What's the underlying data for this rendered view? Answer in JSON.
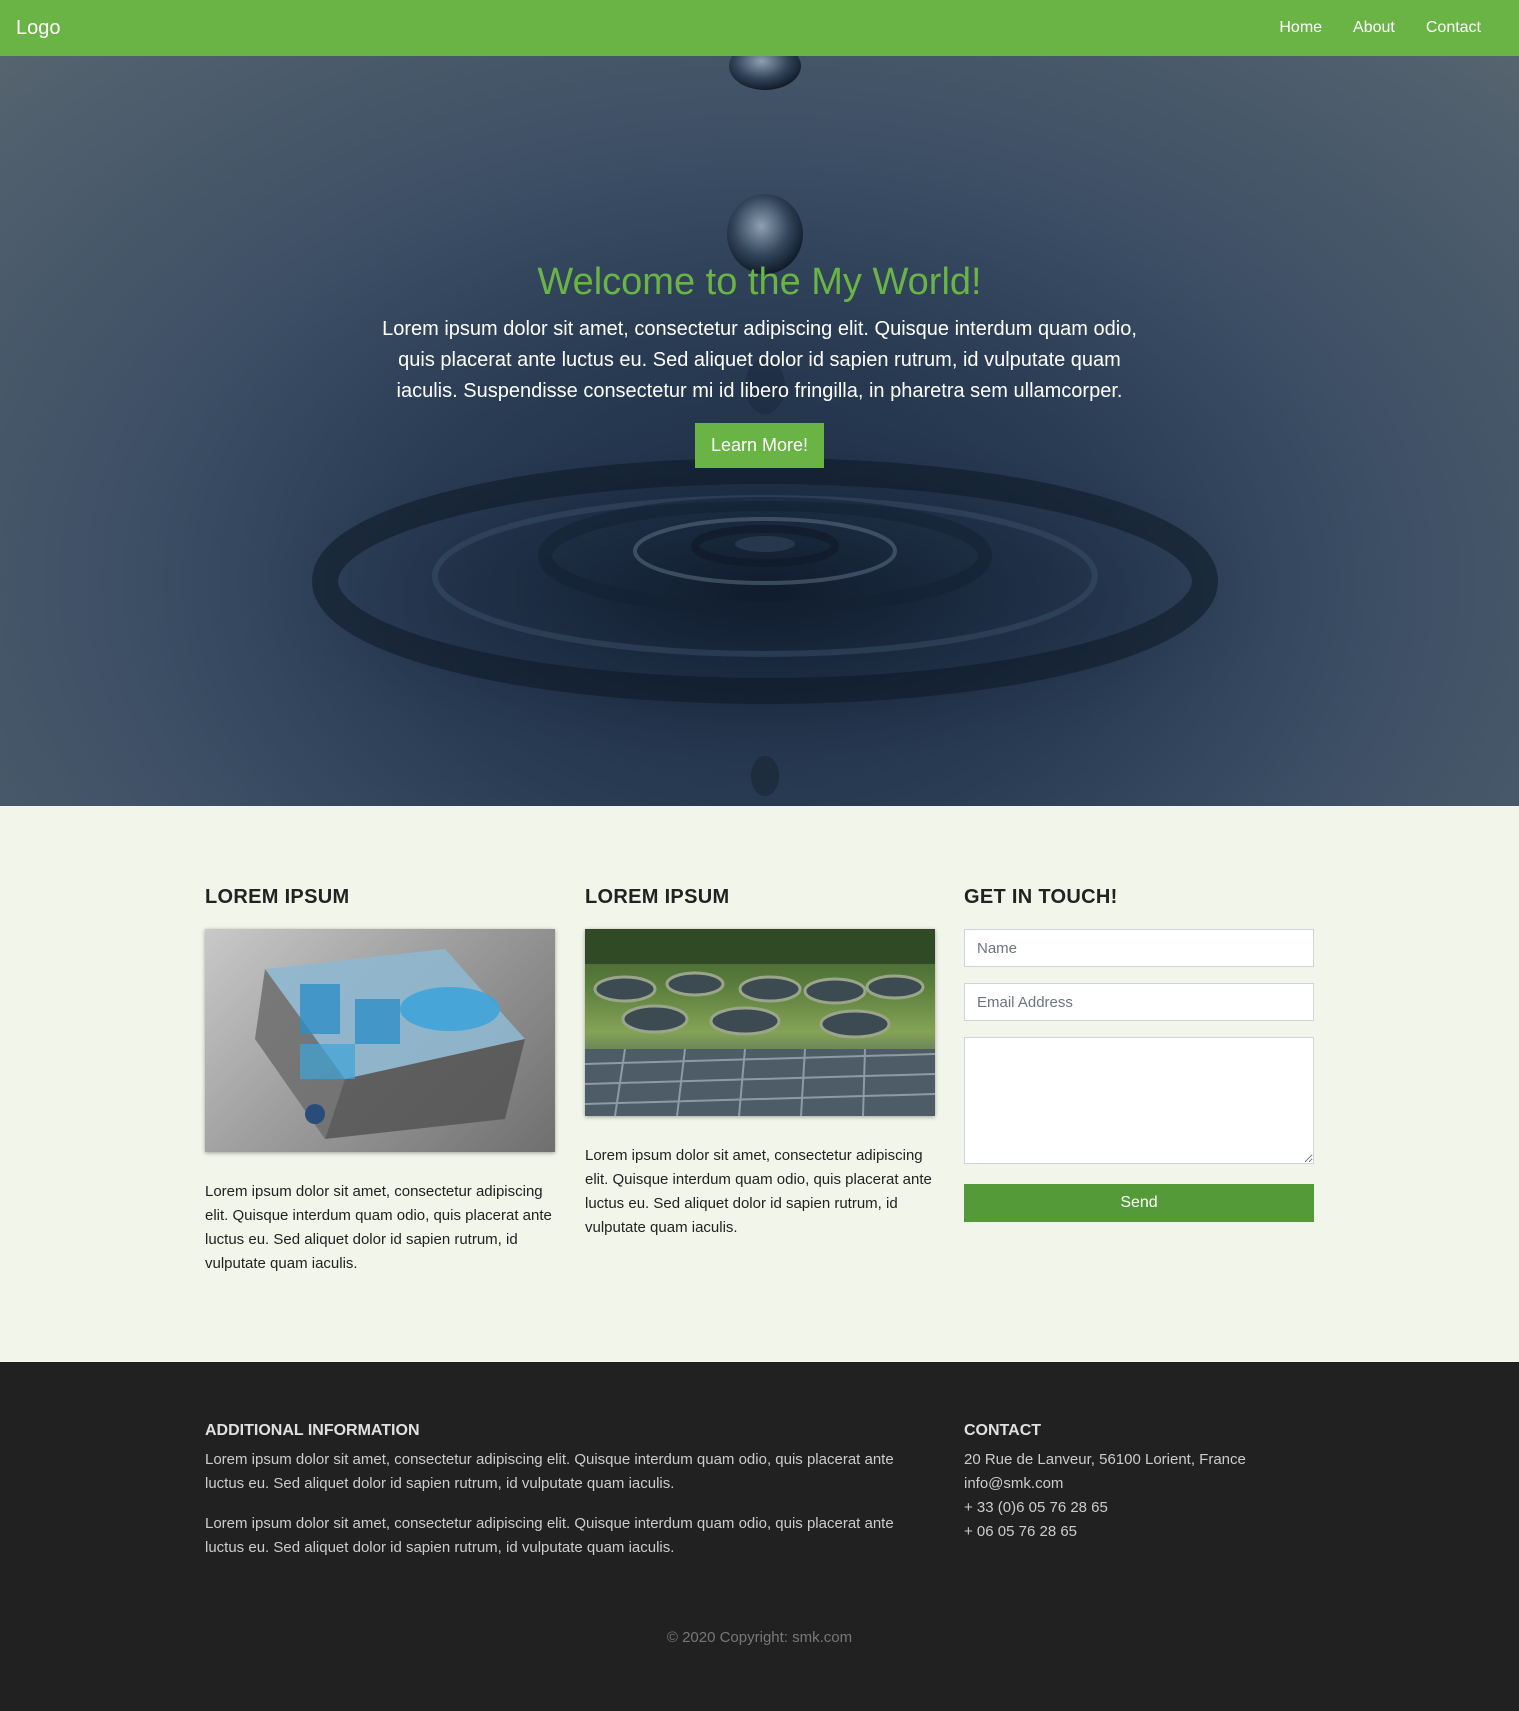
{
  "nav": {
    "logo": "Logo",
    "links": [
      "Home",
      "About",
      "Contact"
    ]
  },
  "hero": {
    "title": "Welcome to the My World!",
    "text": "Lorem ipsum dolor sit amet, consectetur adipiscing elit. Quisque interdum quam odio, quis placerat ante luctus eu. Sed aliquet dolor id sapien rutrum, id vulputate quam iaculis. Suspendisse consectetur mi id libero fringilla, in pharetra sem ullamcorper.",
    "button": "Learn More!"
  },
  "cards": [
    {
      "title": "LOREM IPSUM",
      "text": "Lorem ipsum dolor sit amet, consectetur adipiscing elit. Quisque interdum quam odio, quis placerat ante luctus eu. Sed aliquet dolor id sapien rutrum, id vulputate quam iaculis."
    },
    {
      "title": "LOREM IPSUM",
      "text": "Lorem ipsum dolor sit amet, consectetur adipiscing elit. Quisque interdum quam odio, quis placerat ante luctus eu. Sed aliquet dolor id sapien rutrum, id vulputate quam iaculis."
    }
  ],
  "contact_form": {
    "title": "GET IN TOUCH!",
    "name_placeholder": "Name",
    "email_placeholder": "Email Address",
    "message_value": "",
    "send": "Send"
  },
  "footer": {
    "info_title": "ADDITIONAL INFORMATION",
    "info_paragraphs": [
      "Lorem ipsum dolor sit amet, consectetur adipiscing elit. Quisque interdum quam odio, quis placerat ante luctus eu. Sed aliquet dolor id sapien rutrum, id vulputate quam iaculis.",
      "Lorem ipsum dolor sit amet, consectetur adipiscing elit. Quisque interdum quam odio, quis placerat ante luctus eu. Sed aliquet dolor id sapien rutrum, id vulputate quam iaculis."
    ],
    "contact_title": "CONTACT",
    "contact_lines": [
      "20 Rue de Lanveur, 56100 Lorient, France",
      "info@smk.com",
      "+ 33 (0)6 05 76 28 65",
      "+ 06 05 76 28 65"
    ],
    "copyright": "© 2020 Copyright: smk.com"
  },
  "colors": {
    "brand_green": "#6ab446",
    "button_green": "#559a38",
    "content_bg": "#f1f5ea",
    "footer_bg": "#212121"
  }
}
